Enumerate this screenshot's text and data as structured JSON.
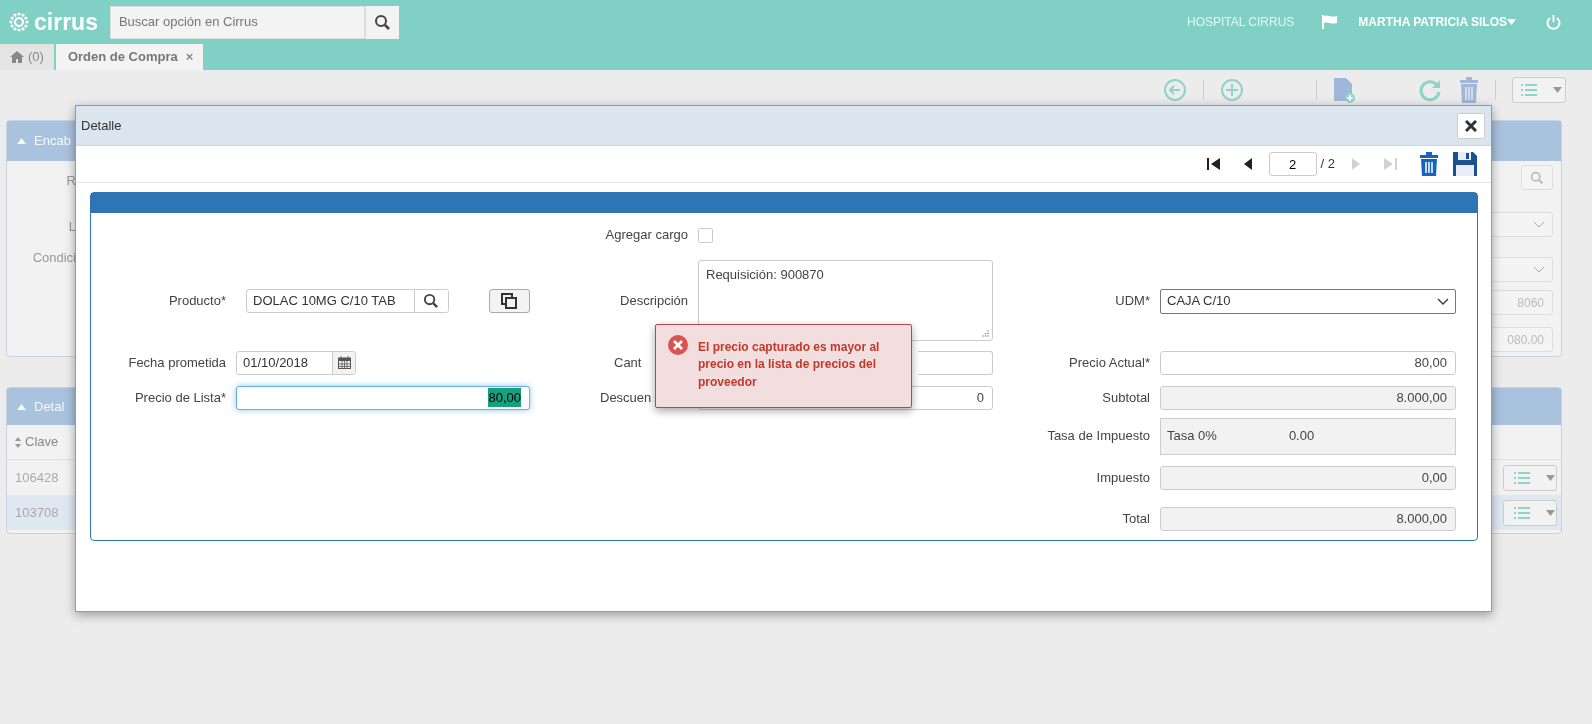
{
  "header": {
    "logo": "cirrus",
    "search": {
      "placeholder": "Buscar opción en Cirrus"
    },
    "organization": "HOSPITAL CIRRUS",
    "user": "MARTHA PATRICIA SILOS"
  },
  "tabs": [
    {
      "kind": "home",
      "label": "(0)",
      "selected": false
    },
    {
      "kind": "document",
      "label": "Orden de Compra",
      "close": "×",
      "selected": true
    }
  ],
  "background": {
    "header_panel": {
      "title": "Encab",
      "labels": [
        "R",
        "L",
        "Condici"
      ],
      "values": [
        "8060",
        "080.00"
      ]
    },
    "detail_panel": {
      "title": "Detal",
      "column": "Clave",
      "rows": [
        {
          "cell": "106428",
          "selected": false
        },
        {
          "cell": "103708",
          "selected": true
        }
      ]
    }
  },
  "dialog": {
    "title": "Detalle",
    "pager": {
      "page": "2",
      "total": "/ 2",
      "buttons": [
        {
          "kind": "first",
          "disabled": false
        },
        {
          "kind": "previous",
          "disabled": false
        },
        {
          "kind": "next",
          "disabled": true
        },
        {
          "kind": "last",
          "disabled": true
        }
      ]
    },
    "fields": [
      {
        "kind": "checkbox",
        "label": "Agregar cargo",
        "checked": false
      },
      {
        "kind": "lookup",
        "label": "Producto*",
        "value": "DOLAC 10MG C/10 TAB"
      },
      {
        "kind": "textarea",
        "label": "Descripción",
        "value": "Requisición: 900870"
      },
      {
        "kind": "select",
        "label": "UDM*",
        "value": "CAJA C/10"
      },
      {
        "kind": "date",
        "label": "Fecha prometida",
        "value": "01/10/2018"
      },
      {
        "kind": "text",
        "label": "Cant",
        "readonly": false
      },
      {
        "kind": "text",
        "label": "Precio Actual*",
        "value": "80,00",
        "readonly": false
      },
      {
        "kind": "text",
        "label": "Precio de Lista*",
        "value": "80,00",
        "readonly": false,
        "focused": true
      },
      {
        "kind": "text",
        "label": "Descuen",
        "value": "0",
        "readonly": false
      },
      {
        "kind": "text",
        "label": "Subtotal",
        "value": "8.000,00",
        "readonly": true
      },
      {
        "kind": "rate",
        "label": "Tasa de Impuesto",
        "value": "Tasa 0%",
        "rate": "0.00"
      },
      {
        "kind": "text",
        "label": "Impuesto",
        "value": "0,00",
        "readonly": true
      },
      {
        "kind": "text",
        "label": "Total",
        "value": "8.000,00",
        "readonly": true
      }
    ],
    "alert": {
      "message": "El precio capturado es mayor al precio en la lista de precios del proveedor"
    }
  }
}
